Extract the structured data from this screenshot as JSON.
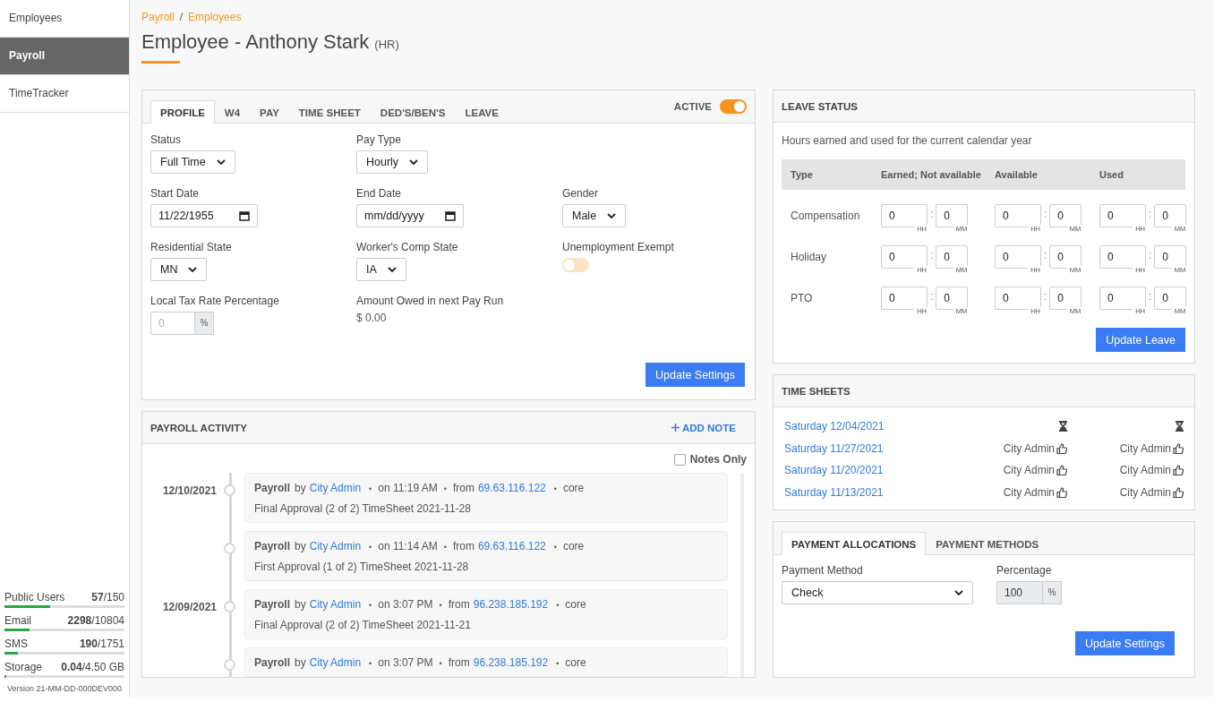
{
  "sidebar": {
    "items": [
      {
        "label": "Employees",
        "selected": false
      },
      {
        "label": "Payroll",
        "selected": true
      },
      {
        "label": "TimeTracker",
        "selected": false
      }
    ],
    "usage": [
      {
        "label": "Public Users",
        "count": "**57**/150",
        "level": 0.38
      },
      {
        "label": "Email",
        "count": "**2298**/10804",
        "level": 0.21
      },
      {
        "label": "SMS",
        "count": "**190**/1751",
        "level": 0.11
      },
      {
        "label": "Storage",
        "count": "**0.04**/4.50 GB",
        "level": 0.015
      }
    ],
    "version": "Version 21-MM-DD-000DEV000"
  },
  "breadcrumb": [
    {
      "label": "Payroll"
    },
    {
      "separator": "/"
    },
    {
      "label": "Employees"
    }
  ],
  "title": "Employee - Anthony Stark",
  "title_tag": "(HR)",
  "profile": {
    "tabs": [
      {
        "label": "PROFILE",
        "selected": true
      },
      {
        "label": "W4",
        "selected": false
      },
      {
        "label": "PAY",
        "selected": false
      },
      {
        "label": "TIME SHEET",
        "selected": false
      },
      {
        "label": "DED'S/BEN'S",
        "selected": false
      },
      {
        "label": "LEAVE",
        "selected": false
      }
    ],
    "active_toggle": {
      "label": "ACTIVE",
      "on": true
    },
    "rows": [
      [
        {
          "kind": "select",
          "label": "Status",
          "value": "Full Time"
        },
        {
          "kind": "select",
          "label": "Pay Type",
          "value": "Hourly"
        }
      ],
      [
        {
          "kind": "date",
          "label": "Start Date",
          "value": "11/22/1955"
        },
        {
          "kind": "date",
          "label": "End Date",
          "placeholder": "mm/dd/yyyy"
        },
        {
          "kind": "select",
          "label": "Gender",
          "value": "Male"
        }
      ],
      [
        {
          "kind": "select",
          "label": "Residential State",
          "value": "MN"
        },
        {
          "kind": "select",
          "label": "Worker's Comp State",
          "value": "IA"
        },
        {
          "kind": "toggle",
          "label": "Unemployment Exempt",
          "on": false
        }
      ],
      [
        {
          "kind": "percent",
          "label": "Local Tax Rate Percentage",
          "placeholder": "0",
          "unit": "%"
        },
        {
          "kind": "text",
          "label": "Amount Owed in next Pay Run",
          "value": "$ 0.00"
        }
      ]
    ],
    "button": "Update Settings"
  },
  "activity": {
    "title": "PAYROLL ACTIVITY",
    "add_note": "ADD NOTE",
    "notes_only": {
      "label": "Notes Only",
      "checked": false
    },
    "entries": [
      {
        "date": "12/10/2021",
        "meta": [
          {
            "kind": "source",
            "text": "Payroll"
          },
          {
            "kind": "plain",
            "text": "by"
          },
          {
            "kind": "user",
            "text": "City Admin"
          },
          {
            "kind": "dot",
            "text": "•"
          },
          {
            "kind": "plain",
            "text": "on 11:19 AM"
          },
          {
            "kind": "dot",
            "text": "•"
          },
          {
            "kind": "plain",
            "text": "from"
          },
          {
            "kind": "ip",
            "text": "69.63.116.122"
          },
          {
            "kind": "dot",
            "text": "•"
          },
          {
            "kind": "plain",
            "text": "core"
          }
        ],
        "message": "Final Approval (2 of 2) TimeSheet 2021-11-28"
      },
      {
        "meta": [
          {
            "kind": "source",
            "text": "Payroll"
          },
          {
            "kind": "plain",
            "text": "by"
          },
          {
            "kind": "user",
            "text": "City Admin"
          },
          {
            "kind": "dot",
            "text": "•"
          },
          {
            "kind": "plain",
            "text": "on 11:14 AM"
          },
          {
            "kind": "dot",
            "text": "•"
          },
          {
            "kind": "plain",
            "text": "from"
          },
          {
            "kind": "ip",
            "text": "69.63.116.122"
          },
          {
            "kind": "dot",
            "text": "•"
          },
          {
            "kind": "plain",
            "text": "core"
          }
        ],
        "message": "First Approval (1 of 2) TimeSheet 2021-11-28"
      },
      {
        "date": "12/09/2021",
        "meta": [
          {
            "kind": "source",
            "text": "Payroll"
          },
          {
            "kind": "plain",
            "text": "by"
          },
          {
            "kind": "user",
            "text": "City Admin"
          },
          {
            "kind": "dot",
            "text": "•"
          },
          {
            "kind": "plain",
            "text": "on 3:07 PM"
          },
          {
            "kind": "dot",
            "text": "•"
          },
          {
            "kind": "plain",
            "text": "from"
          },
          {
            "kind": "ip",
            "text": "96.238.185.192"
          },
          {
            "kind": "dot",
            "text": "•"
          },
          {
            "kind": "plain",
            "text": "core"
          }
        ],
        "message": "Final Approval (2 of 2) TimeSheet 2021-11-21"
      },
      {
        "meta": [
          {
            "kind": "source",
            "text": "Payroll"
          },
          {
            "kind": "plain",
            "text": "by"
          },
          {
            "kind": "user",
            "text": "City Admin"
          },
          {
            "kind": "dot",
            "text": "•"
          },
          {
            "kind": "plain",
            "text": "on 3:07 PM"
          },
          {
            "kind": "dot",
            "text": "•"
          },
          {
            "kind": "plain",
            "text": "from"
          },
          {
            "kind": "ip",
            "text": "96.238.185.192"
          },
          {
            "kind": "dot",
            "text": "•"
          },
          {
            "kind": "plain",
            "text": "core"
          }
        ]
      }
    ]
  },
  "leave": {
    "title": "LEAVE STATUS",
    "subtitle": "Hours earned and used for the current calendar year",
    "columns": [
      "Type",
      "Earned; Not available",
      "Available",
      "Used"
    ],
    "rows": [
      {
        "cells": [
          {
            "kind": "label",
            "text": "Compensation"
          },
          {
            "kind": "time",
            "hours": "0",
            "hours_unit": "HH",
            "separator": ":",
            "minutes": "0",
            "minutes_unit": "MM"
          },
          {
            "hours": "0",
            "hours_unit": "HH",
            "separator": ":",
            "minutes": "0",
            "minutes_unit": "MM"
          },
          {
            "hours": "0",
            "hours_unit": "HH",
            "separator": ":",
            "minutes": "0",
            "minutes_unit": "MM"
          }
        ]
      },
      {
        "cells": [
          {
            "kind": "label",
            "text": "Holiday"
          },
          {
            "kind": "time",
            "hours": "0",
            "hours_unit": "HH",
            "separator": ":",
            "minutes": "0",
            "minutes_unit": "MM"
          },
          {
            "hours": "0",
            "hours_unit": "HH",
            "separator": ":",
            "minutes": "0",
            "minutes_unit": "MM"
          },
          {
            "hours": "0",
            "hours_unit": "HH",
            "separator": ":",
            "minutes": "0",
            "minutes_unit": "MM"
          }
        ]
      },
      {
        "cells": [
          {
            "kind": "label",
            "text": "PTO"
          },
          {
            "kind": "time",
            "hours": "0",
            "hours_unit": "HH",
            "separator": ":",
            "minutes": "0",
            "minutes_unit": "MM"
          },
          {
            "hours": "0",
            "hours_unit": "HH",
            "separator": ":",
            "minutes": "0",
            "minutes_unit": "MM"
          },
          {
            "hours": "0",
            "hours_unit": "HH",
            "separator": ":",
            "minutes": "0",
            "minutes_unit": "MM"
          }
        ]
      }
    ],
    "button": "Update Leave"
  },
  "time_sheets": {
    "title": "TIME SHEETS",
    "rows": [
      {
        "date": "Saturday 12/04/2021",
        "approvals": [
          {
            "kind": "pending"
          },
          {
            "kind": "pending"
          }
        ]
      },
      {
        "date": "Saturday 11/27/2021",
        "approvals": [
          {
            "kind": "approved",
            "by": "City Admin"
          },
          {
            "kind": "approved",
            "by": "City Admin"
          }
        ]
      },
      {
        "date": "Saturday 11/20/2021",
        "approvals": [
          {
            "kind": "approved",
            "by": "City Admin"
          },
          {
            "kind": "approved",
            "by": "City Admin"
          }
        ]
      },
      {
        "date": "Saturday 11/13/2021",
        "approvals": [
          {
            "kind": "approved",
            "by": "City Admin"
          },
          {
            "kind": "approved",
            "by": "City Admin"
          }
        ]
      }
    ]
  },
  "payment": {
    "tabs": [
      {
        "label": "PAYMENT ALLOCATIONS",
        "selected": true
      },
      {
        "label": "PAYMENT METHODS",
        "selected": false
      }
    ],
    "method": {
      "label": "Payment Method",
      "value": "Check"
    },
    "percentage": {
      "label": "Percentage",
      "value": "100",
      "unit": "%",
      "disabled": true
    },
    "button": "Update Settings"
  }
}
